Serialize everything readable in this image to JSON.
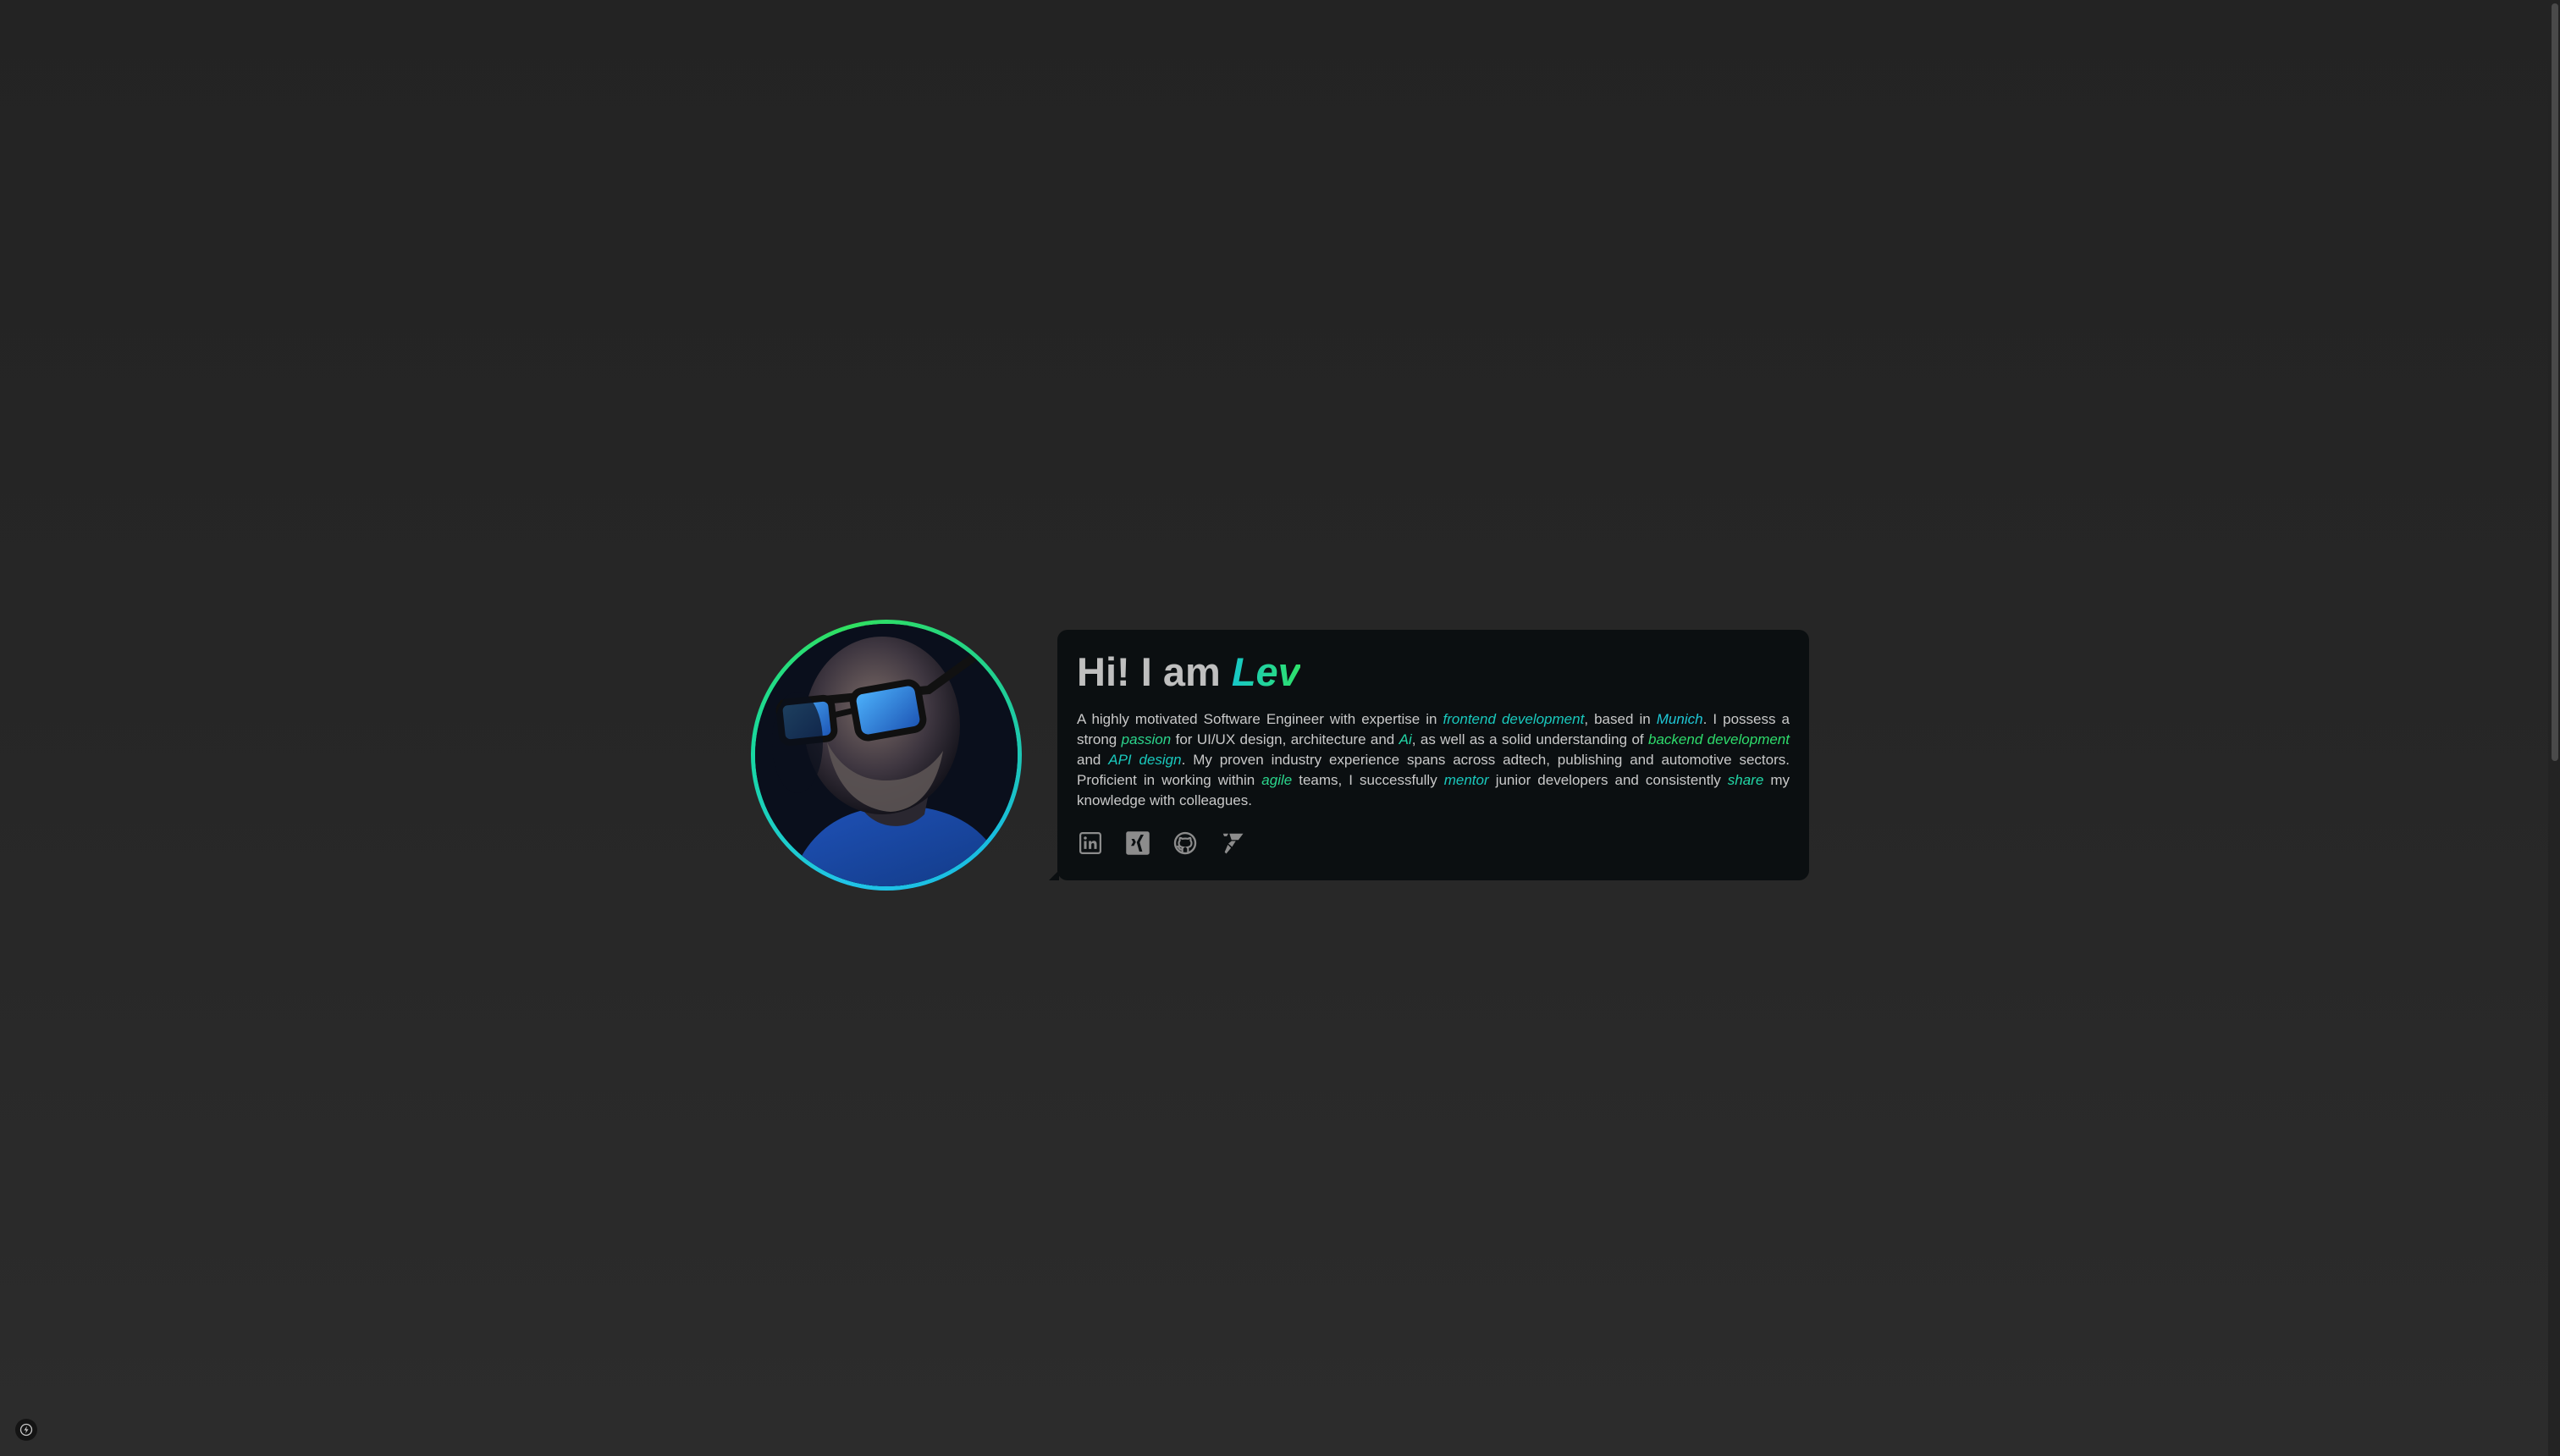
{
  "hero": {
    "greeting": "Hi! I am ",
    "name": "Lev",
    "bio": [
      {
        "t": "A highly motivated Software Engineer with expertise in "
      },
      {
        "t": "frontend development",
        "hl": "c1"
      },
      {
        "t": ", based in "
      },
      {
        "t": "Munich",
        "hl": "c2"
      },
      {
        "t": ". I possess a strong "
      },
      {
        "t": "passion",
        "hl": "c3"
      },
      {
        "t": " for UI/UX design, architecture and "
      },
      {
        "t": "Ai",
        "hl": "c4"
      },
      {
        "t": ", as well as a solid understanding of "
      },
      {
        "t": "backend development",
        "hl": "c5"
      },
      {
        "t": " and "
      },
      {
        "t": "API design",
        "hl": "c1"
      },
      {
        "t": ". My proven industry experience spans across adtech, publishing and automotive sectors. Proficient in working within "
      },
      {
        "t": "agile",
        "hl": "c3"
      },
      {
        "t": " teams, I successfully "
      },
      {
        "t": "mentor",
        "hl": "c1"
      },
      {
        "t": " junior developers and consistently "
      },
      {
        "t": "share",
        "hl": "c4"
      },
      {
        "t": " my knowledge with colleagues."
      }
    ],
    "socials": [
      {
        "icon": "linkedin-icon"
      },
      {
        "icon": "xing-icon"
      },
      {
        "icon": "github-icon"
      },
      {
        "icon": "freelancer-icon"
      }
    ]
  },
  "colors": {
    "accent_start": "#17c7c9",
    "accent_end": "#2ee16a",
    "card_bg": "#0b0f11",
    "page_bg": "#262626"
  }
}
